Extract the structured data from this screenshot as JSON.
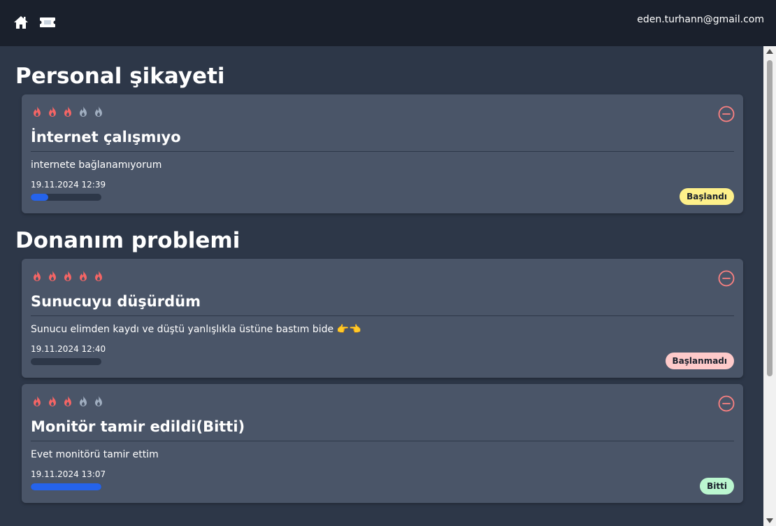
{
  "header": {
    "user_email": "eden.turhann@gmail.com",
    "icons": [
      "home-icon",
      "ticket-icon"
    ]
  },
  "colors": {
    "flame_active": "#f56565",
    "flame_inactive": "#a0aec0",
    "progress_fill": "#2563eb",
    "remove": "#fc8181"
  },
  "sections": [
    {
      "title": "Personal şikayeti",
      "tickets": [
        {
          "priority": 3,
          "max_priority": 5,
          "title": "İnternet çalışmıyo",
          "description": "internete bağlanamıyorum",
          "date": "19.11.2024 12:39",
          "progress": 0.25,
          "status": "Başlandı",
          "status_color": "#fef08a"
        }
      ]
    },
    {
      "title": "Donanım problemi",
      "tickets": [
        {
          "priority": 5,
          "max_priority": 5,
          "title": "Sunucuyu düşürdüm",
          "description": "Sunucu elimden kaydı ve düştü yanlışlıkla üstüne bastım bide 👉👈",
          "date": "19.11.2024 12:40",
          "progress": 0,
          "status": "Başlanmadı",
          "status_color": "#fecaca"
        },
        {
          "priority": 3,
          "max_priority": 5,
          "title": "Monitör tamir edildi(Bitti)",
          "description": "Evet monitörü tamir ettim",
          "date": "19.11.2024 13:07",
          "progress": 1,
          "status": "Bitti",
          "status_color": "#bbf7d0"
        }
      ]
    }
  ]
}
